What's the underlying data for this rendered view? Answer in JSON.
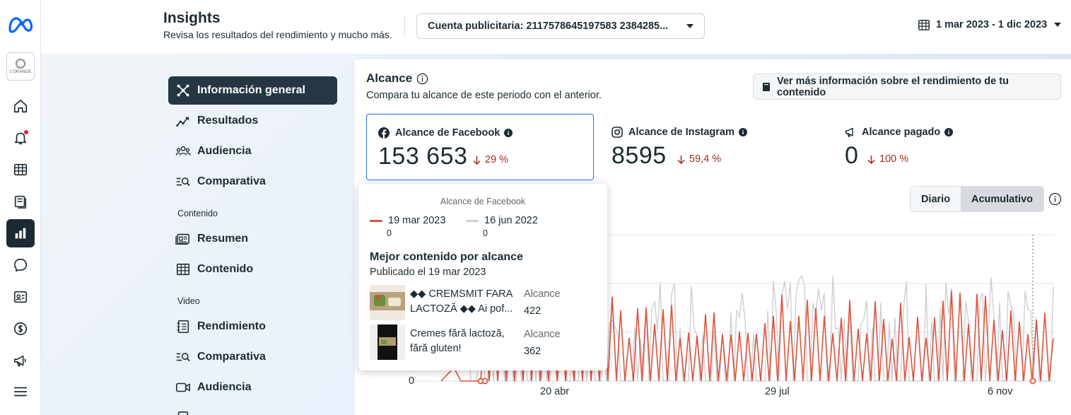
{
  "header": {
    "title": "Insights",
    "subtitle": "Revisa los resultados del rendimiento y mucho más.",
    "account_select": "Cuenta publicitaria: 2117578645197583 2384285...",
    "date_range": "1 mar 2023 - 1 dic 2023"
  },
  "rail": {
    "account_logo_text": "L'ORANGE"
  },
  "nav": {
    "items": [
      {
        "label": "Información general",
        "icon": "overview-icon"
      },
      {
        "label": "Resultados",
        "icon": "results-icon"
      },
      {
        "label": "Audiencia",
        "icon": "audience-icon"
      },
      {
        "label": "Comparativa",
        "icon": "benchmark-icon"
      }
    ],
    "section_content": "Contenido",
    "content_items": [
      {
        "label": "Resumen",
        "icon": "summary-icon"
      },
      {
        "label": "Contenido",
        "icon": "content-table-icon"
      }
    ],
    "section_video": "Video",
    "video_items": [
      {
        "label": "Rendimiento",
        "icon": "performance-icon"
      },
      {
        "label": "Comparativa",
        "icon": "benchmark-icon"
      },
      {
        "label": "Audiencia",
        "icon": "video-icon"
      }
    ]
  },
  "main": {
    "title": "Alcance",
    "subtitle": "Compara tu alcance de este periodo con el anterior.",
    "more_button": "Ver más información sobre el rendimiento de tu contenido",
    "metrics": [
      {
        "label": "Alcance de Facebook",
        "value": "153 653",
        "change": "29 %"
      },
      {
        "label": "Alcance de Instagram",
        "value": "8595",
        "change": "59,4 %"
      },
      {
        "label": "Alcance pagado",
        "value": "0",
        "change": "100 %"
      }
    ],
    "toggle": {
      "daily": "Diario",
      "cumulative": "Acumulativo"
    }
  },
  "tooltip": {
    "title": "Alcance de Facebook",
    "legend": [
      {
        "date": "19 mar 2023",
        "value": "0",
        "color": "#e0533d"
      },
      {
        "date": "16 jun 2022",
        "value": "0",
        "color": "#ced0d4"
      }
    ],
    "best_title": "Mejor contenido por alcance",
    "published": "Publicado el 19 mar 2023",
    "posts": [
      {
        "text": "◆◆ CREMSMIT FARA LACTOZĂ ◆◆ Ai pof...",
        "reach_label": "Alcance",
        "reach": "422"
      },
      {
        "text": "Cremes fără lactoză, fără gluten!",
        "reach_label": "Alcance",
        "reach": "362"
      }
    ]
  },
  "chart_data": {
    "type": "line",
    "x_ticks": [
      "20 abr",
      "29 jul",
      "6 nov"
    ],
    "y_ticks": [
      "0"
    ],
    "series": [
      {
        "color": "#e0533d"
      },
      {
        "color": "#ced0d4"
      }
    ]
  }
}
